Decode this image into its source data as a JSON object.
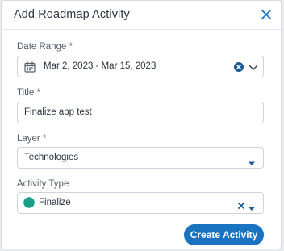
{
  "dialog": {
    "title": "Add Roadmap Activity",
    "close_icon": "close-icon"
  },
  "date_range": {
    "label": "Date Range *",
    "value": "Mar 2, 2023 - Mar 15, 2023",
    "icons": [
      "calendar-icon",
      "clear-circle-icon",
      "chevron-down-icon"
    ]
  },
  "title_field": {
    "label": "Title *",
    "value": "Finalize app test"
  },
  "layer": {
    "label": "Layer *",
    "value": "Technologies",
    "icon": "caret-down-icon"
  },
  "activity_type": {
    "label": "Activity Type",
    "value": "Finalize",
    "color": "#1b9e87",
    "icons": [
      "clear-x-icon",
      "caret-down-icon"
    ]
  },
  "actions": {
    "create_label": "Create Activity"
  },
  "colors": {
    "accent": "#1a73c1",
    "clear_icon": "#1a5a9a"
  }
}
